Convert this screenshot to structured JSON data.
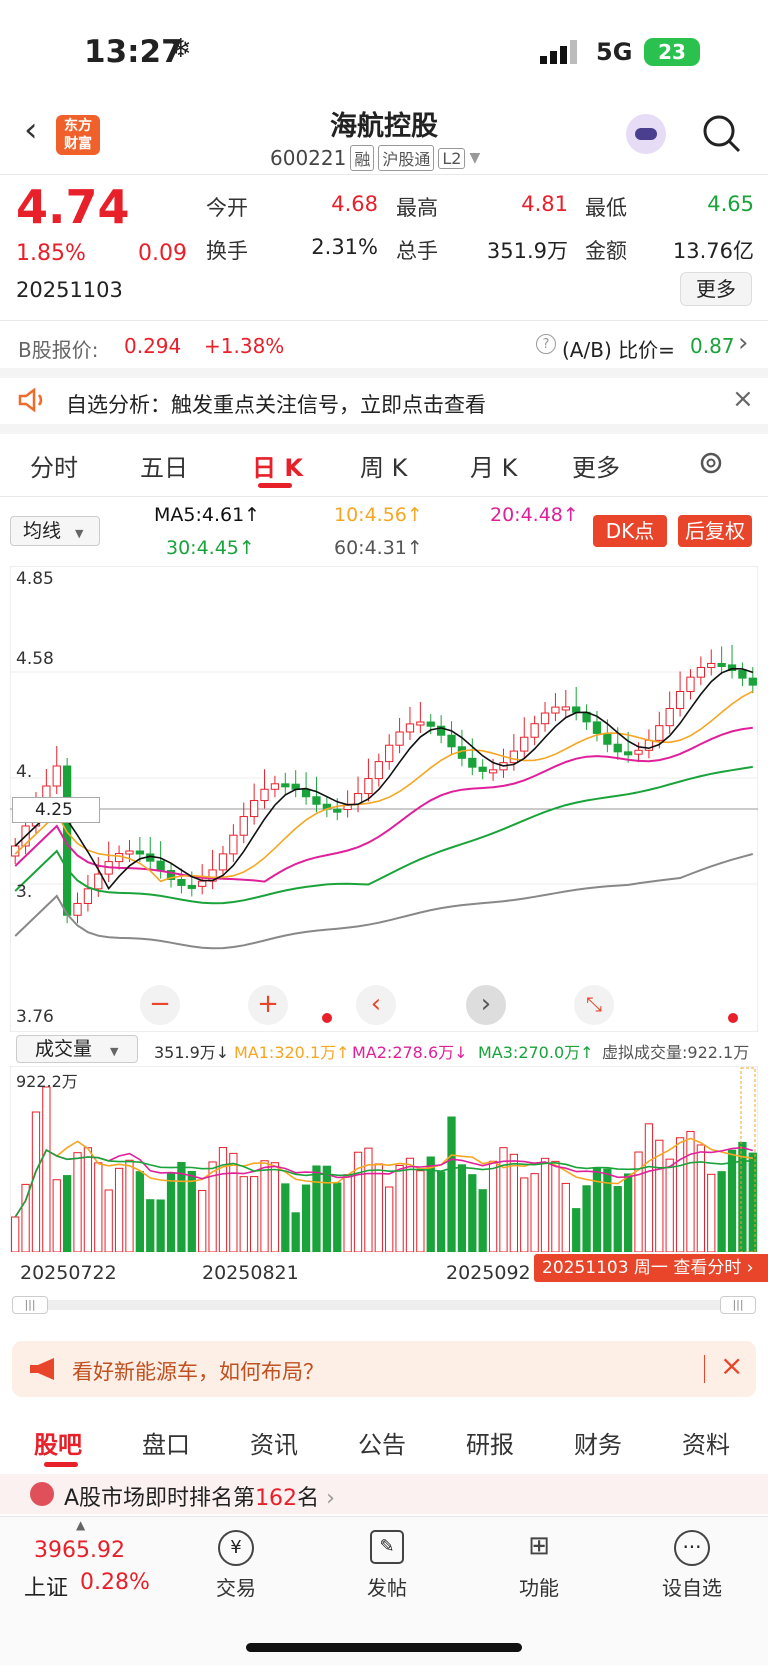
{
  "status": {
    "time": "13:27",
    "network": "5G",
    "battery": "23"
  },
  "header": {
    "title": "海航控股",
    "code": "600221",
    "tags": [
      "融",
      "沪股通",
      "L2"
    ],
    "logo_line1": "东方",
    "logo_line2": "财富"
  },
  "quote": {
    "price": "4.74",
    "change_pct": "1.85%",
    "change": "0.09",
    "date": "20251103",
    "open_label": "今开",
    "open": "4.68",
    "high_label": "最高",
    "high": "4.81",
    "low_label": "最低",
    "low": "4.65",
    "turnover_label": "换手",
    "turnover": "2.31%",
    "volume_label": "总手",
    "volume": "351.9万",
    "amount_label": "金额",
    "amount": "13.76亿",
    "more": "更多"
  },
  "bshare": {
    "label": "B股报价:",
    "price": "0.294",
    "pct": "+1.38%",
    "ratio_label": "(A/B) 比价=",
    "ratio": "0.87"
  },
  "notice": {
    "text": "自选分析：触发重点关注信号，立即点击查看"
  },
  "ktabs": [
    "分时",
    "五日",
    "日 K",
    "周 K",
    "月 K",
    "更多"
  ],
  "ma_line": {
    "selector": "均线",
    "ma5": "MA5:4.61↑",
    "ma10": "10:4.56↑",
    "ma20": "20:4.48↑",
    "ma30": "30:4.45↑",
    "ma60": "60:4.31↑",
    "dk_btn": "DK点",
    "fq_btn": "后复权"
  },
  "price_axis": {
    "top": "4.85",
    "p2": "4.58",
    "p3": "4.",
    "p4": "4.25",
    "p5": "3.",
    "bottom": "3.76",
    "crosshair": "4.25"
  },
  "volume_line": {
    "selector": "成交量",
    "vol": "351.9万↓",
    "ma1": "MA1:320.1万↑",
    "ma2": "MA2:278.6万↓",
    "ma3": "MA3:270.0万↑",
    "virtual": "虚拟成交量:922.1万",
    "top": "922.2万"
  },
  "dates": {
    "d1": "20250722",
    "d2": "20250821",
    "d3": "2025092",
    "badge": "20251103 周一 查看分时"
  },
  "ad": {
    "text": "看好新能源车，如何布局？"
  },
  "bottom_tabs": [
    "股吧",
    "盘口",
    "资讯",
    "公告",
    "研报",
    "财务",
    "资料"
  ],
  "rank": {
    "prefix": "A股市场即时排名第",
    "num": "162",
    "suffix": "名"
  },
  "index": {
    "value": "3965.92",
    "name": "上证",
    "pct": "0.28%"
  },
  "nav": [
    "交易",
    "发帖",
    "功能",
    "设自选"
  ],
  "colors": {
    "up": "#e8202a",
    "down": "#1aa33a",
    "ma5": "#111111",
    "ma10": "#f5a623",
    "ma20": "#e0209a",
    "ma30": "#1aa33a",
    "ma60": "#888888"
  }
}
